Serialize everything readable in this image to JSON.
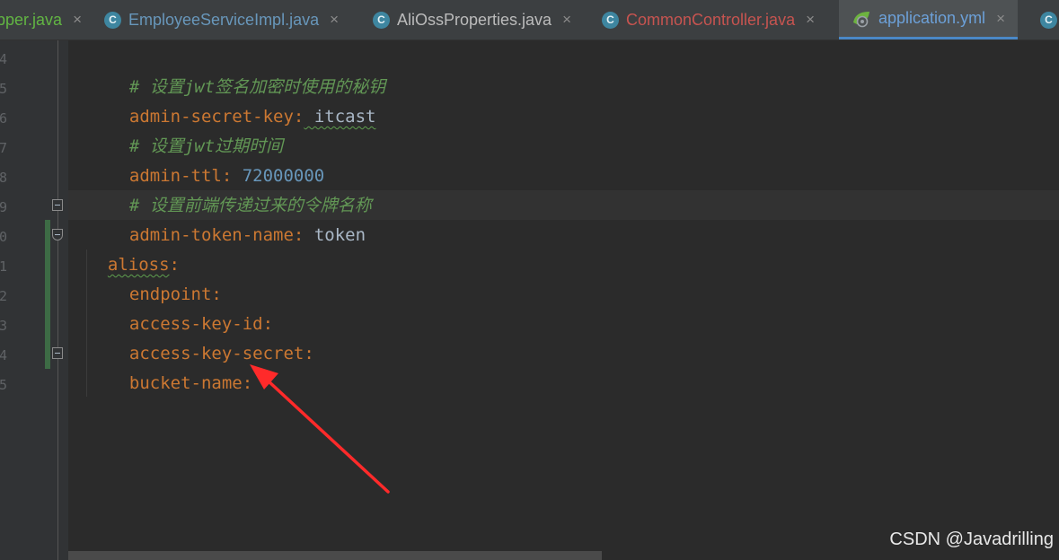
{
  "tabs": [
    {
      "label": "pper.java",
      "icon": "none",
      "color": "#62b543"
    },
    {
      "label": "EmployeeServiceImpl.java",
      "icon": "class-icon",
      "color": "#6897bb"
    },
    {
      "label": "AliOssProperties.java",
      "icon": "class-icon",
      "color": "#bbbbbb"
    },
    {
      "label": "CommonController.java",
      "icon": "class-icon",
      "color": "#c75450"
    },
    {
      "label": "application.yml",
      "icon": "spring-yml-icon",
      "color": "#6ca0d8",
      "active": true
    },
    {
      "label": "",
      "icon": "class-icon"
    }
  ],
  "tab_icon_letter": "C",
  "close_glyph": "×",
  "gutter": {
    "line_numbers": [
      "4",
      "5",
      "6",
      "7",
      "8",
      "9",
      "0",
      "1",
      "2",
      "3",
      "4",
      "5"
    ]
  },
  "code": {
    "lines": [
      {
        "type": "comment",
        "text": "# 设置jwt签名加密时使用的秘钥"
      },
      {
        "type": "pair",
        "key": "admin-secret-key",
        "colon": ":",
        "value": " itcast"
      },
      {
        "type": "comment",
        "text": "# 设置jwt过期时间"
      },
      {
        "type": "pair",
        "key": "admin-ttl",
        "colon": ":",
        "value": " 72000000"
      },
      {
        "type": "comment",
        "text": "# 设置前端传递过来的令牌名称"
      },
      {
        "type": "pair",
        "key": "admin-token-name",
        "colon": ":",
        "value": " token"
      },
      {
        "type": "pair",
        "key": "alioss",
        "colon": ":",
        "value": ""
      },
      {
        "type": "pair",
        "key": "endpoint",
        "colon": ":",
        "value": ""
      },
      {
        "type": "pair",
        "key": "access-key-id",
        "colon": ":",
        "value": ""
      },
      {
        "type": "pair",
        "key": "access-key-secret",
        "colon": ":",
        "value": ""
      },
      {
        "type": "pair",
        "key": "bucket-name",
        "colon": ":",
        "value": ""
      }
    ]
  },
  "annotation": {
    "color": "#ff2a2a",
    "points_to": "bucket-name"
  },
  "watermark": "CSDN @Javadrilling",
  "colors": {
    "background": "#2b2b2b",
    "keyword": "#cc7832",
    "comment": "#629755",
    "number": "#6897bb",
    "text": "#a9b7c6"
  }
}
